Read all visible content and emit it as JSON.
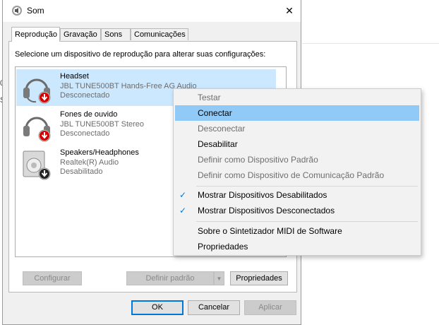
{
  "background": {
    "snippet1": "0",
    "snippet2": "S"
  },
  "window": {
    "title": "Som",
    "close_glyph": "✕"
  },
  "tabs": [
    {
      "label": "Reprodução",
      "active": true
    },
    {
      "label": "Gravação",
      "active": false
    },
    {
      "label": "Sons",
      "active": false
    },
    {
      "label": "Comunicações",
      "active": false
    }
  ],
  "instruction": "Selecione um dispositivo de reprodução para alterar suas configurações:",
  "devices": [
    {
      "name": "Headset",
      "model": "JBL TUNE500BT Hands-Free AG Audio",
      "status": "Desconectado",
      "icon": "headset-icon",
      "badge": "red-down-arrow",
      "selected": true
    },
    {
      "name": "Fones de ouvido",
      "model": "JBL TUNE500BT Stereo",
      "status": "Desconectado",
      "icon": "headphones-icon",
      "badge": "red-down-arrow",
      "selected": false
    },
    {
      "name": "Speakers/Headphones",
      "model": "Realtek(R) Audio",
      "status": "Desabilitado",
      "icon": "speaker-icon",
      "badge": "black-down-arrow",
      "selected": false
    }
  ],
  "panel_buttons": {
    "configure": "Configurar",
    "set_default": "Definir padrão",
    "properties": "Propriedades"
  },
  "dialog_buttons": {
    "ok": "OK",
    "cancel": "Cancelar",
    "apply": "Aplicar"
  },
  "context_menu": {
    "items": [
      {
        "label": "Testar",
        "enabled": false
      },
      {
        "label": "Conectar",
        "enabled": true,
        "highlighted": true
      },
      {
        "label": "Desconectar",
        "enabled": false
      },
      {
        "label": "Desabilitar",
        "enabled": true
      },
      {
        "label": "Definir como Dispositivo Padrão",
        "enabled": false
      },
      {
        "label": "Definir como Dispositivo de Comunicação Padrão",
        "enabled": false
      },
      {
        "label": "Mostrar Dispositivos Desabilitados",
        "enabled": true,
        "checked": true
      },
      {
        "label": "Mostrar Dispositivos Desconectados",
        "enabled": true,
        "checked": true
      },
      {
        "label": "Sobre o Sintetizador MIDI de Software",
        "enabled": true
      },
      {
        "label": "Propriedades",
        "enabled": true
      }
    ],
    "check_glyph": "✓"
  },
  "colors": {
    "selection": "#cce8ff",
    "menu_highlight": "#91c9f7",
    "accent": "#0078d7",
    "badge_red": "#d40000"
  }
}
